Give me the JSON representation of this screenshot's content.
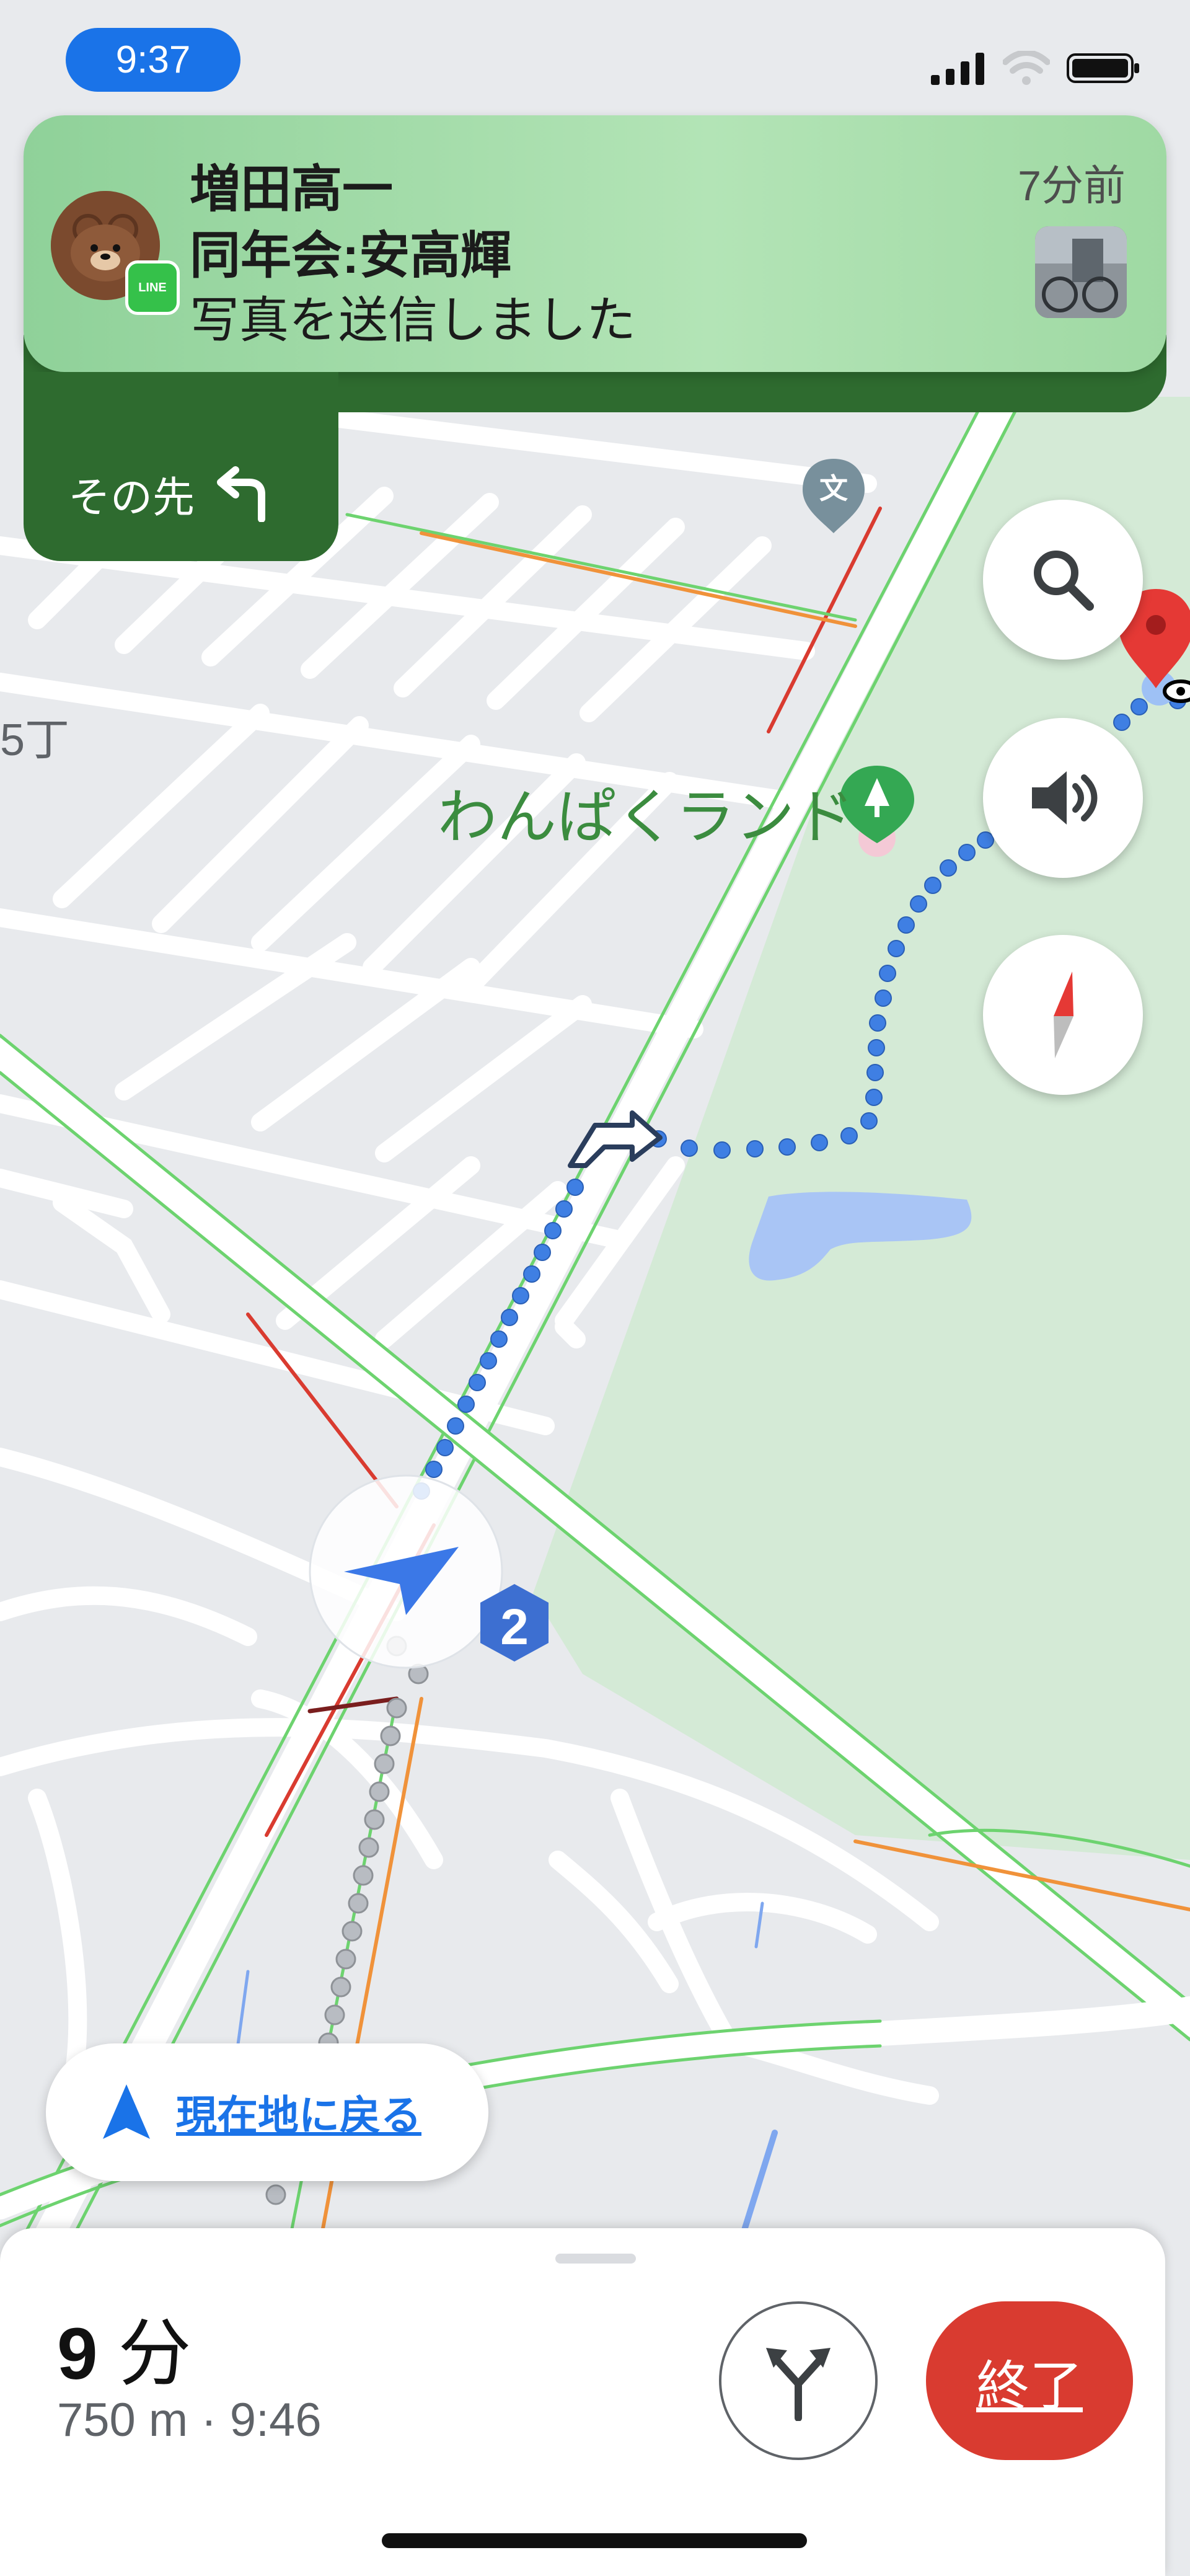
{
  "status_bar": {
    "time": "9:37"
  },
  "notification": {
    "app": "LINE",
    "sender": "増田高一",
    "group": "同年会:安高輝",
    "message": "写真を送信しました",
    "time_ago": "7分前"
  },
  "next_step": {
    "label": "その先"
  },
  "map": {
    "park_label": "わんぱくランド",
    "street_number": "5丁",
    "school_marker": "文",
    "step_badge": "2"
  },
  "recenter": {
    "label": "現在地に戻る"
  },
  "trip": {
    "duration_value": "9",
    "duration_unit": "分",
    "distance_arrival": "750 m · 9:46",
    "end_label": "終了"
  },
  "colors": {
    "accent": "#1a73e8",
    "banner_green": "#2e6b2f",
    "end_red": "#d93b30",
    "park_green": "#d4ead6"
  }
}
